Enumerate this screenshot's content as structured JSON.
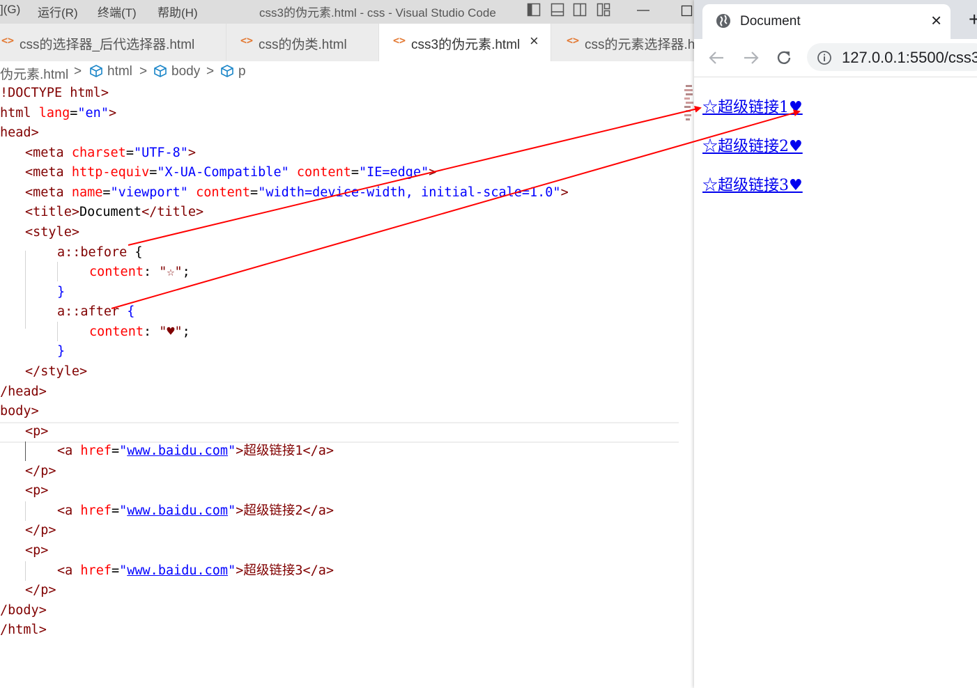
{
  "vscode": {
    "menu": [
      "](G)",
      "运行(R)",
      "终端(T)",
      "帮助(H)"
    ],
    "window_title": "css3的伪元素.html - css - Visual Studio Code",
    "tabs": [
      {
        "icon": "<>",
        "label": "css的选择器_后代选择器.html",
        "active": false
      },
      {
        "icon": "<>",
        "label": "css的伪类.html",
        "active": false
      },
      {
        "icon": "<>",
        "label": "css3的伪元素.html",
        "active": true,
        "close": "×"
      },
      {
        "icon": "<>",
        "label": "css的元素选择器.h",
        "active": false
      }
    ],
    "breadcrumb": [
      "伪元素.html",
      "html",
      "body",
      "p"
    ],
    "breadcrumb_sep": ">",
    "code": {
      "l1": {
        "a": "!DOCTYPE",
        "b": "html",
        "c": ">"
      },
      "l2": {
        "a": "html",
        "b": "lang",
        "c": "=",
        "d": "\"en\"",
        "e": ">"
      },
      "l3": {
        "a": "head",
        "b": ">"
      },
      "l4": {
        "a": "<meta",
        "b": "charset",
        "c": "=",
        "d": "\"UTF-8\"",
        "e": ">"
      },
      "l5": {
        "a": "<meta",
        "b": "http-equiv",
        "c": "=",
        "d": "\"X-UA-Compatible\"",
        "e": "content",
        "f": "=",
        "g": "\"IE=edge\"",
        "h": ">"
      },
      "l6": {
        "a": "<meta",
        "b": "name",
        "c": "=",
        "d": "\"viewport\"",
        "e": "content",
        "f": "=",
        "g": "\"width=device-width, initial-scale=1.0\"",
        "h": ">"
      },
      "l7": {
        "a": "<title>",
        "b": "Document",
        "c": "</title>"
      },
      "l8": {
        "a": "<style>"
      },
      "l9": {
        "a": "a::before",
        "b": "{"
      },
      "l10": {
        "a": "content",
        "b": ":",
        "c": "\"☆\"",
        "d": ";"
      },
      "l11": {
        "a": "}"
      },
      "l12": {
        "a": "a::after",
        "b": "{"
      },
      "l13": {
        "a": "content",
        "b": ":",
        "c": "\"♥\"",
        "d": ";"
      },
      "l14": {
        "a": "}"
      },
      "l15": {
        "a": "</style>"
      },
      "l16": {
        "a": "/head",
        "b": ">"
      },
      "l17": {
        "a": "body",
        "b": ">"
      },
      "l18": {
        "a": "<p>"
      },
      "l19": {
        "a": "<a",
        "b": "href",
        "c": "=",
        "d": "\"",
        "e": "www.baidu.com",
        "f": "\"",
        "g": ">超级链接1</a>"
      },
      "l20": {
        "a": "</p>"
      },
      "l21": {
        "a": "<p>"
      },
      "l22": {
        "a": "<a",
        "b": "href",
        "c": "=",
        "d": "\"",
        "e": "www.baidu.com",
        "f": "\"",
        "g": ">超级链接2</a>"
      },
      "l23": {
        "a": "</p>"
      },
      "l24": {
        "a": "<p>"
      },
      "l25": {
        "a": "<a",
        "b": "href",
        "c": "=",
        "d": "\"",
        "e": "www.baidu.com",
        "f": "\"",
        "g": ">超级链接3</a>"
      },
      "l26": {
        "a": "</p>"
      },
      "l27": {
        "a": "/body",
        "b": ">"
      },
      "l28": {
        "a": "/html",
        "b": ">"
      }
    }
  },
  "browser": {
    "tab_title": "Document",
    "tab_close": "×",
    "new_tab": "+",
    "url": "127.0.0.1:5500/css3",
    "links": [
      "☆超级链接1♥",
      "☆超级链接2♥",
      "☆超级链接3♥"
    ]
  },
  "colors": {
    "arrow": "#ff0000",
    "link": "#0000ee",
    "tag": "#800000",
    "attr": "#ff0000",
    "string": "#0000ff"
  }
}
